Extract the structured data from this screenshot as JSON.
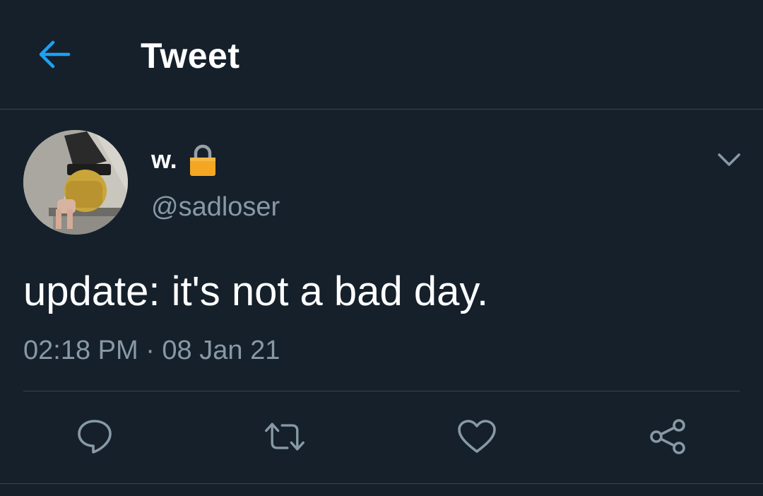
{
  "header": {
    "title": "Tweet",
    "back_icon": "arrow-left-icon"
  },
  "author": {
    "display_name": "w.",
    "protected_icon": "lock-icon",
    "handle": "@sadloser"
  },
  "tweet": {
    "text": "update: it's not a bad day.",
    "timestamp": "02:18 PM · 08 Jan 21"
  },
  "actions": [
    {
      "name": "reply",
      "icon": "speech-bubble-icon"
    },
    {
      "name": "retweet",
      "icon": "retweet-icon"
    },
    {
      "name": "like",
      "icon": "heart-icon"
    },
    {
      "name": "share",
      "icon": "share-icon"
    }
  ],
  "colors": {
    "background": "#15202b",
    "accent": "#1da1f2",
    "secondary_text": "#8899a6",
    "divider": "#38444d",
    "lock": "#f5a623"
  }
}
